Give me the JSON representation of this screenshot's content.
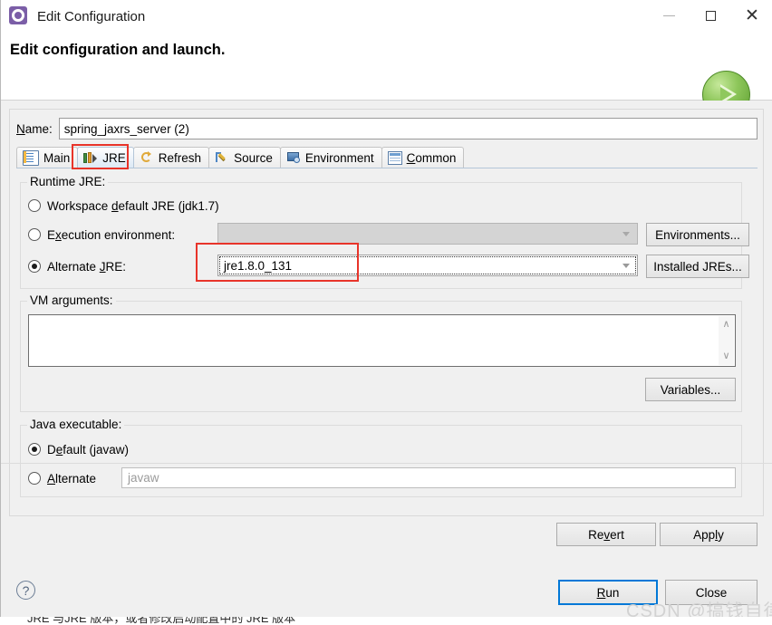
{
  "window": {
    "title": "Edit Configuration",
    "icon": "gear-icon",
    "minimize": "—",
    "maximize": "□",
    "close": "✕"
  },
  "header": {
    "title": "Edit configuration and launch.",
    "run_badge_icon": "green-run-play-icon"
  },
  "name_field": {
    "label_pre": "N",
    "label_post": "ame:",
    "value": "spring_jaxrs_server (2)"
  },
  "tabs": [
    {
      "label": "Main",
      "icon": "document-icon",
      "selected": false
    },
    {
      "label": "JRE",
      "icon": "books-icon",
      "selected": true
    },
    {
      "label": "Refresh",
      "icon": "refresh-icon",
      "selected": false
    },
    {
      "label": "Source",
      "icon": "pencil-icon",
      "selected": false
    },
    {
      "label": "Environment",
      "icon": "monitor-icon",
      "selected": false
    },
    {
      "label": "Common",
      "icon": "grid-icon",
      "selected": false
    }
  ],
  "runtime_jre": {
    "group_title": "Runtime JRE:",
    "options": [
      {
        "label": "Workspace default JRE (jdk1.7)",
        "checked": false
      },
      {
        "label": "Execution environment:",
        "checked": false
      },
      {
        "label": "Alternate JRE:",
        "checked": true
      }
    ],
    "execution_env_value": "",
    "alternate_jre_value": "jre1.8.0_131",
    "environments_button": "Environments...",
    "installed_jres_button": "Installed JREs..."
  },
  "vm_arguments": {
    "group_title": "VM arguments:",
    "value": "",
    "variables_button": "Variables...",
    "scroll_up": "∧",
    "scroll_down": "∨"
  },
  "java_executable": {
    "group_title": "Java executable:",
    "options": [
      {
        "label": "Default (javaw)",
        "checked": true
      },
      {
        "label": "Alternate",
        "checked": false
      }
    ],
    "alternate_placeholder": "javaw"
  },
  "actions": {
    "revert": "Revert",
    "apply": "Apply",
    "run": "Run",
    "close": "Close",
    "help_icon": "?"
  },
  "watermark": "CSDN @搞钱自律",
  "bottom_text": "JRE 与JRE 版本，或者修改启动配置中的 JRE 版本",
  "colors": {
    "annotation": "#e8342a",
    "focus": "#0078d7",
    "dialog_bg": "#f0f0f0"
  }
}
